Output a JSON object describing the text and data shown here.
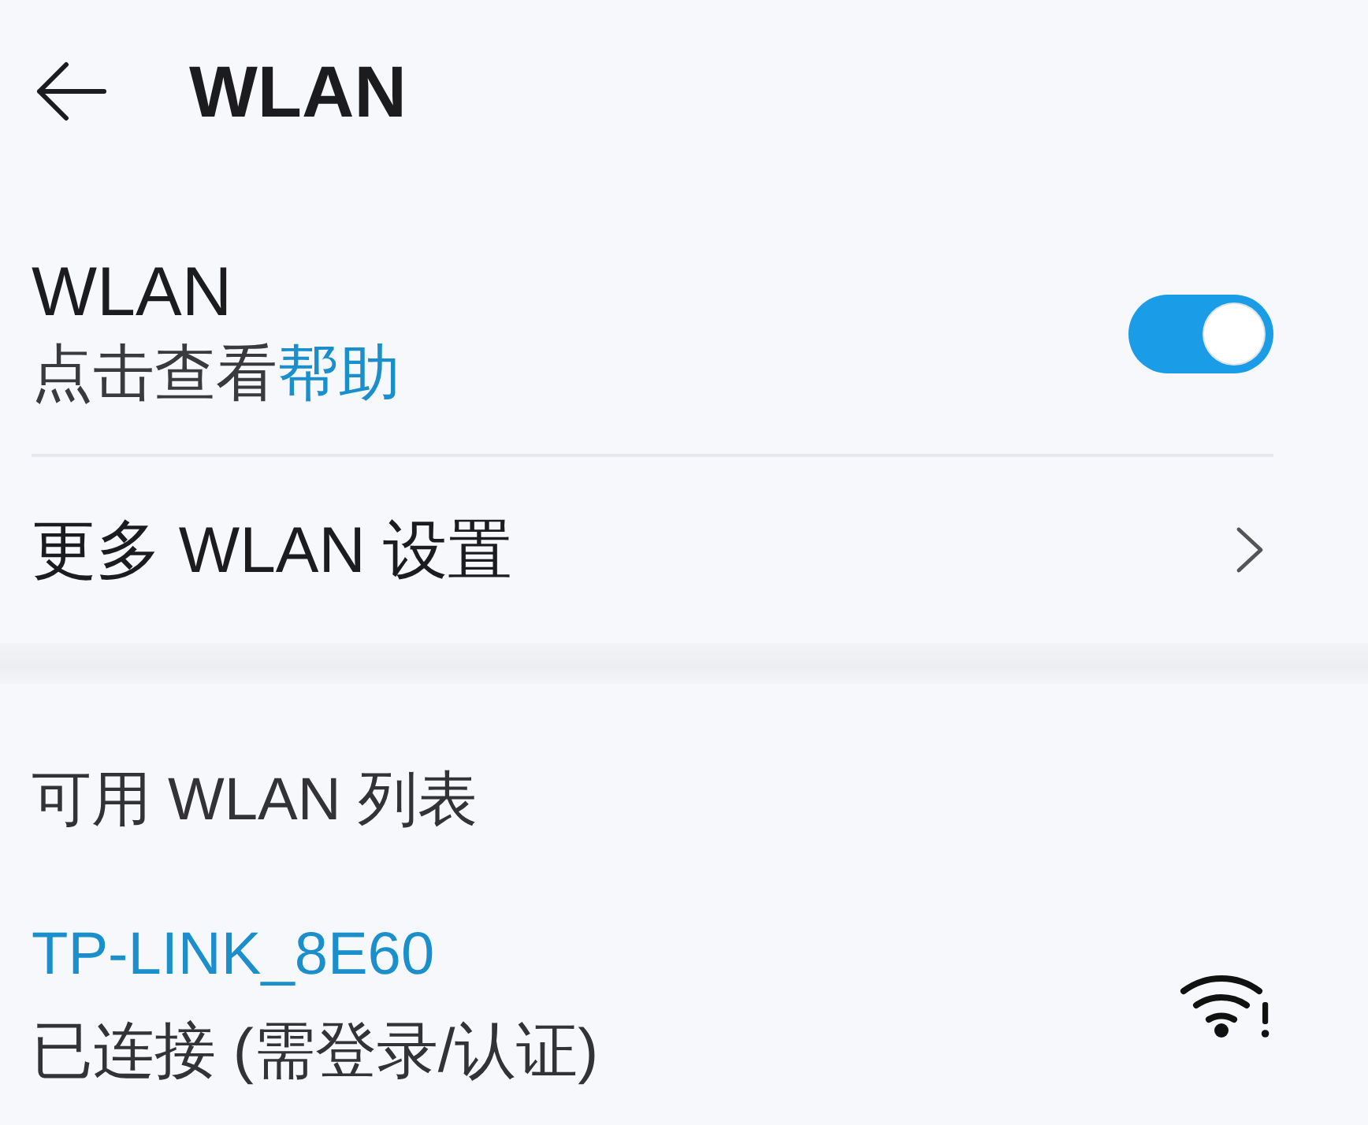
{
  "header": {
    "title": "WLAN"
  },
  "wlan": {
    "label": "WLAN",
    "hint": "点击查看",
    "hint_link": "帮助",
    "on": true
  },
  "more_settings": {
    "label": "更多 WLAN 设置"
  },
  "available": {
    "heading": "可用 WLAN 列表",
    "networks": [
      {
        "name": "TP-LINK_8E60",
        "status": "已连接 (需登录/认证)",
        "connected": true,
        "needs_login": true
      }
    ]
  }
}
